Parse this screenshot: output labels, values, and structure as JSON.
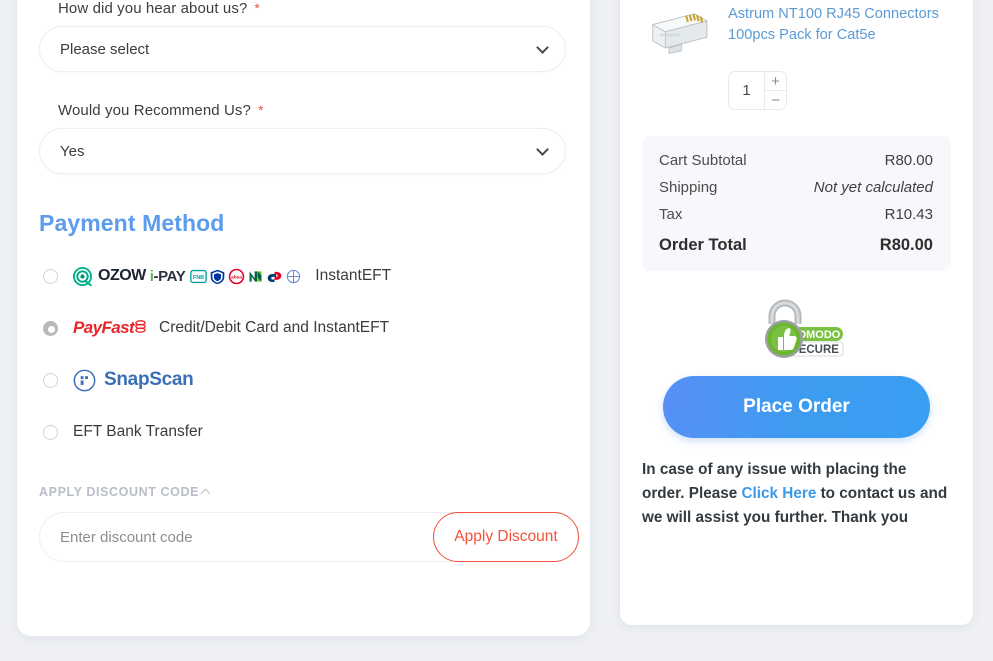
{
  "form": {
    "fields": [
      {
        "label": "How did you hear about us?",
        "required": "*",
        "value": "Please select"
      },
      {
        "label": "Would you Recommend Us?",
        "required": "*",
        "value": "Yes"
      }
    ]
  },
  "payment": {
    "heading": "Payment Method",
    "options": [
      {
        "id": "ozow",
        "selected": false,
        "brand": "OZOW",
        "brand2_i": "i",
        "brand2_pay": "-PAY",
        "label": "InstantEFT",
        "banks": [
          "fnb-icon",
          "standard-bank-icon",
          "absa-icon",
          "nedbank-icon",
          "capitec-icon",
          "african-bank-icon"
        ]
      },
      {
        "id": "payfast",
        "selected": true,
        "brand_pay": "Pay",
        "brand_fast": "Fast",
        "label": "Credit/Debit Card and InstantEFT"
      },
      {
        "id": "snapscan",
        "selected": false,
        "brand": "SnapScan",
        "label": ""
      },
      {
        "id": "eft",
        "selected": false,
        "brand": "",
        "label": "EFT Bank Transfer"
      }
    ]
  },
  "discount": {
    "heading": "APPLY DISCOUNT CODE",
    "placeholder": "Enter discount code",
    "value": "",
    "button": "Apply Discount"
  },
  "summary": {
    "product": {
      "name": "Astrum NT100 RJ45 Connectors 100pcs Pack for Cat5e",
      "qty": "1",
      "plus": "+",
      "minus": "−"
    },
    "totals": [
      {
        "label": "Cart Subtotal",
        "value": "R80.00",
        "italic": false
      },
      {
        "label": "Shipping",
        "value": "Not yet calculated",
        "italic": true
      },
      {
        "label": "Tax",
        "value": "R10.43",
        "italic": false
      }
    ],
    "order_total": {
      "label": "Order Total",
      "value": "R80.00"
    },
    "badge": {
      "top": "COMODO",
      "bottom": "SECURE"
    },
    "place_order": "Place Order",
    "help": {
      "part1": "In case of any issue with placing the order. Please ",
      "link": "Click Here",
      "part2": " to contact us and we will assist you further. Thank you"
    }
  },
  "colors": {
    "page_bg": "#eef0f4",
    "heading_blue": "#5d9cec",
    "link_blue": "#5b9bd5",
    "accent_red": "#f4503c",
    "button_blue": "#3c9cf0"
  }
}
